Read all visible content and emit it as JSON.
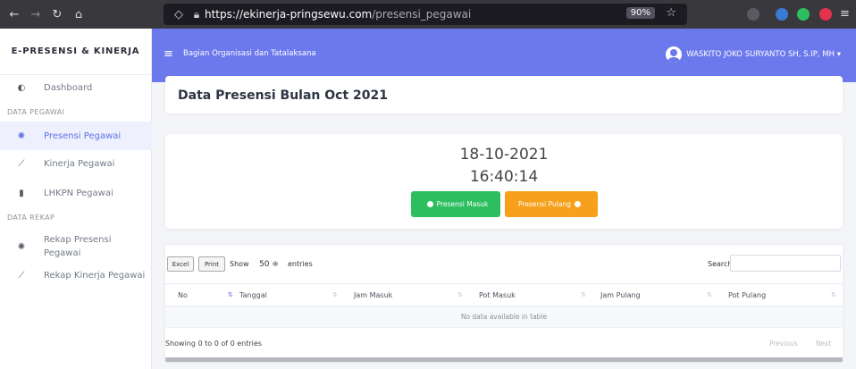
{
  "browser": {
    "url_host": "https://ekinerja-pringsewu.com",
    "url_path": "/presensi_pegawai",
    "zoom": "90%",
    "ext_colors": [
      "#3a7bd5",
      "#2dbe60",
      "#e3324b"
    ]
  },
  "sidebar": {
    "brand": "E-PRESENSI & KINERJA",
    "dashboard": "Dashboard",
    "section_pegawai": "DATA PEGAWAI",
    "presensi": "Presensi Pegawai",
    "kinerja": "Kinerja Pegawai",
    "lhkpn": "LHKPN Pegawai",
    "section_rekap": "DATA REKAP",
    "rekap_presensi_1": "Rekap Presensi",
    "rekap_presensi_2": "Pegawai",
    "rekap_kinerja": "Rekap Kinerja Pegawai"
  },
  "header": {
    "unit": "Bagian Organisasi dan Tatalaksana",
    "user": "WASKITO JOKO SURYANTO SH, S.IP, MH ▾"
  },
  "page": {
    "title": "Data Presensi Bulan Oct 2021",
    "date": "18-10-2021",
    "time": "16:40:14",
    "btn_masuk": "Presensi Masuk",
    "btn_pulang": "Presensi Pulang"
  },
  "table": {
    "excel": "Excel",
    "print": "Print",
    "show": "Show",
    "page_size": "50 ≑",
    "entries": "entries",
    "search": "Search:",
    "columns": [
      "No",
      "Tanggal",
      "Jam Masuk",
      "Pot Masuk",
      "Jam Pulang",
      "Pot Pulang"
    ],
    "empty": "No data available in table",
    "info": "Showing 0 to 0 of 0 entries",
    "previous": "Previous",
    "next": "Next"
  },
  "colors": {
    "accent": "#6c79ec",
    "success": "#2dbe60",
    "warning": "#f6a01b"
  }
}
